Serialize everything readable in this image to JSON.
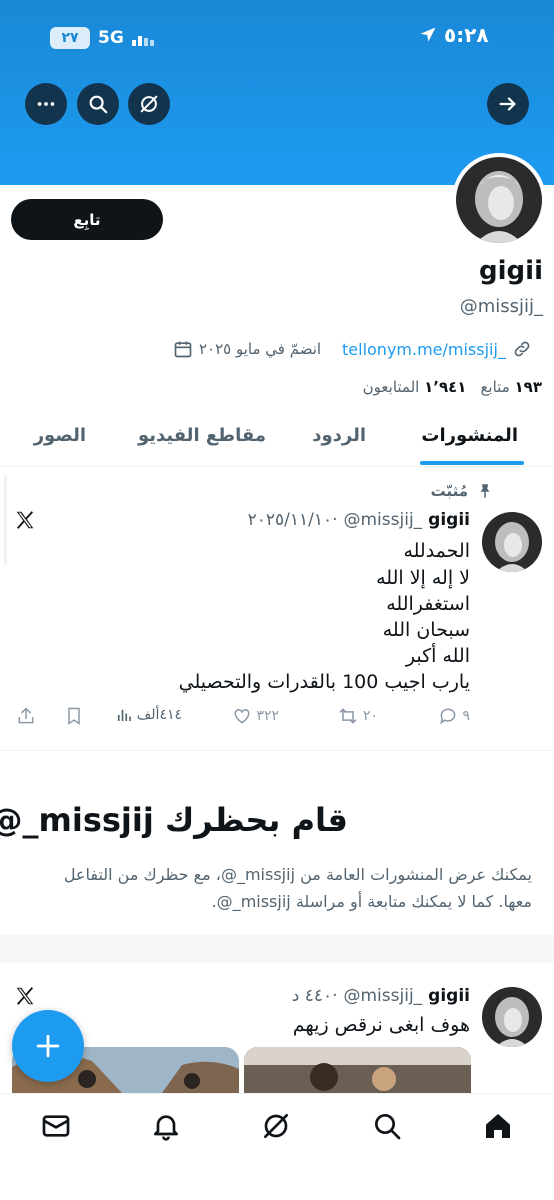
{
  "status_bar": {
    "time": "٥:٢٨",
    "network": "5G",
    "battery": "٢٧"
  },
  "header_icons": {
    "back": "arrow-right-icon",
    "grok": "grok-icon",
    "search": "search-icon",
    "more": "more-icon"
  },
  "profile": {
    "follow_label": "تابِع",
    "name": "gigii",
    "handle": "@missjij_",
    "link": "tellonym.me/missjij_",
    "joined": "انضمّ في مايو ٢٠٢٥",
    "following_count": "١٩٣",
    "following_label": "متابع",
    "followers_count": "١٬٩٤١",
    "followers_label": "المتابعون"
  },
  "tabs": [
    "المنشورات",
    "الردود",
    "مقاطع الفيديو",
    "الصور"
  ],
  "pinned_tweet": {
    "pinned_label": "مُثبّت",
    "author": "gigii",
    "handle": "@missjij_",
    "date": "٢٠٢٥/١١/١٠·",
    "lines": [
      "الحمدلله",
      "لا إله إلا الله",
      "استغفرالله",
      "سبحان الله",
      "الله أكبر",
      "يارب اجيب 100 بالقدرات والتحصيلي"
    ],
    "replies": "٩",
    "retweets": "٢٠",
    "likes": "٣٢٢",
    "views": "٤١٤ألف"
  },
  "blocked_notice": {
    "title": "قام بحظرك missjij_@",
    "body": "يمكنك عرض المنشورات العامة من missjij_@، مع حظرك من التفاعل معها. كما لا يمكنك متابعة أو مراسلة missjij_@."
  },
  "second_tweet": {
    "author": "gigii",
    "handle": "@missjij_",
    "time": "٤٤٠ د·",
    "text": "هوف ابغى نرقص زيهم"
  },
  "bottom_nav": [
    "home-icon",
    "search-icon",
    "grok-icon",
    "notifications-icon",
    "messages-icon"
  ],
  "colors": {
    "accent": "#1d9bf0",
    "text": "#0f1419",
    "secondary": "#536471"
  }
}
